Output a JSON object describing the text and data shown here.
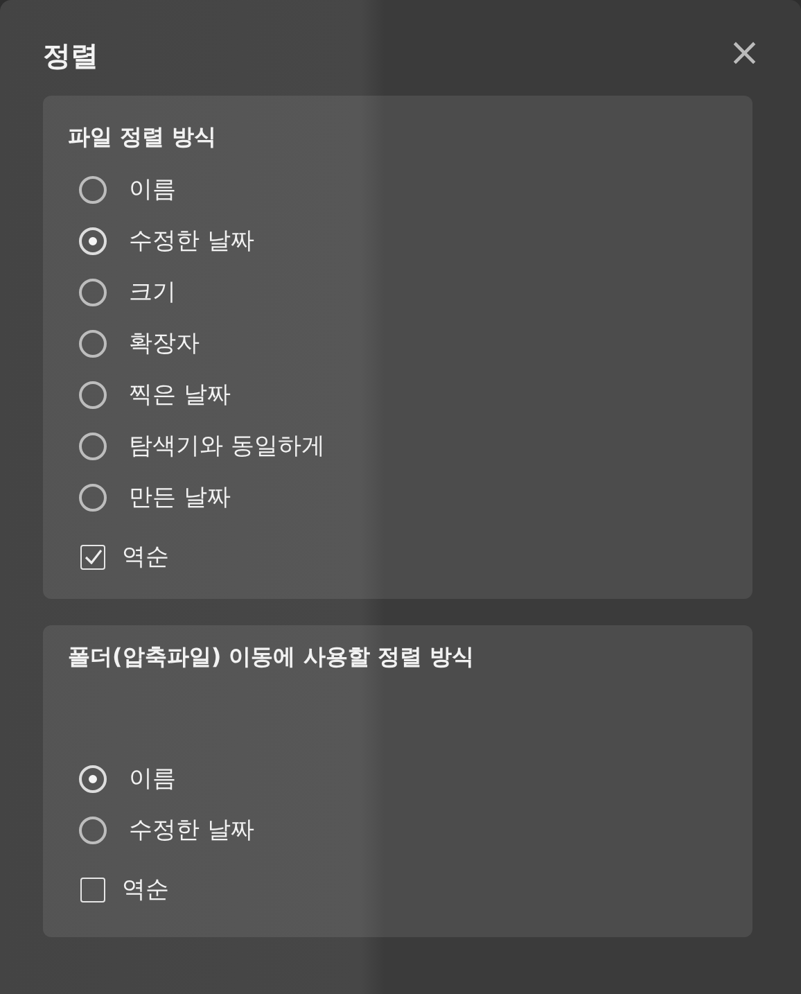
{
  "dialog": {
    "title": "정렬",
    "close": "×"
  },
  "sections": [
    {
      "heading": "파일 정렬 방식",
      "options": [
        {
          "label": "이름",
          "selected": false
        },
        {
          "label": "수정한 날짜",
          "selected": true
        },
        {
          "label": "크기",
          "selected": false
        },
        {
          "label": "확장자",
          "selected": false
        },
        {
          "label": "찍은 날짜",
          "selected": false
        },
        {
          "label": "탐색기와 동일하게",
          "selected": false
        },
        {
          "label": "만든 날짜",
          "selected": false
        }
      ],
      "reverse": {
        "label": "역순",
        "checked": true
      }
    },
    {
      "heading": "폴더(압축파일) 이동에 사용할 정렬 방식",
      "options": [
        {
          "label": "이름",
          "selected": true
        },
        {
          "label": "수정한 날짜",
          "selected": false
        }
      ],
      "reverse": {
        "label": "역순",
        "checked": false
      }
    }
  ]
}
